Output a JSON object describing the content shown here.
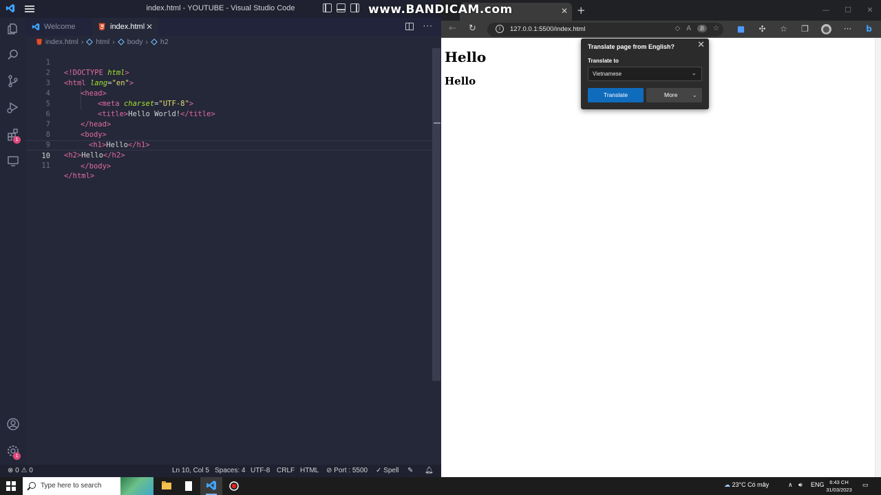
{
  "vscode": {
    "title": "index.html - YOUTUBE - Visual Studio Code",
    "tabs": [
      {
        "label": "Welcome"
      },
      {
        "label": "index.html"
      }
    ],
    "breadcrumb": [
      "index.html",
      "html",
      "body",
      "h2"
    ],
    "code_lines": [
      {
        "num": "1"
      },
      {
        "num": "2"
      },
      {
        "num": "3"
      },
      {
        "num": "4"
      },
      {
        "num": "5"
      },
      {
        "num": "6"
      },
      {
        "num": "7"
      },
      {
        "num": "8"
      },
      {
        "num": "9"
      },
      {
        "num": "10"
      },
      {
        "num": "11"
      }
    ],
    "code": {
      "l1_tag": "<!DOCTYPE ",
      "l1_attr": "html",
      "l1_end": ">",
      "l2_tag": "<html ",
      "l2_attr": "lang",
      "l2_eq": "=",
      "l2_val": "\"en\"",
      "l2_end": ">",
      "l3": "<head>",
      "l4_tag": "<meta ",
      "l4_attr": "charset",
      "l4_eq": "=",
      "l4_val": "\"UTF-8\"",
      "l4_end": ">",
      "l5_open": "<title>",
      "l5_text": "Hello World!",
      "l5_close": "</title>",
      "l6": "</head>",
      "l7": "<body>",
      "l8_open": "<h1>",
      "l8_text": "Hello",
      "l8_close": "</h1>",
      "l9_open": "<h2>",
      "l9_text": "Hello",
      "l9_close": "</h2>",
      "l10": "</body>",
      "l11": "</html>"
    },
    "status": {
      "errors": "0",
      "warnings": "0",
      "position": "Ln 10, Col 5",
      "spaces": "Spaces: 4",
      "encoding": "UTF-8",
      "eol": "CRLF",
      "language": "HTML",
      "port": "Port : 5500",
      "spell": "Spell"
    },
    "badges": {
      "extensions": "1",
      "settings": "1"
    }
  },
  "browser": {
    "watermark": "www.BANDICAM.com",
    "url": "127.0.0.1:5500/index.html",
    "page_h1": "Hello",
    "page_h2": "Hello",
    "translate_popup": {
      "title": "Translate page from English?",
      "label": "Translate to",
      "language": "Vietnamese",
      "translate_btn": "Translate",
      "more_btn": "More"
    }
  },
  "taskbar": {
    "search_placeholder": "Type here to search",
    "weather": "23°C  Có mây",
    "lang": "ENG",
    "time": "6:43 CH",
    "date": "31/03/2023"
  },
  "colors": {
    "accent_blue": "#0f6cbd",
    "tag_pink": "#e06c9f",
    "attr_green": "#a6e22e",
    "string_yellow": "#e6db74"
  }
}
